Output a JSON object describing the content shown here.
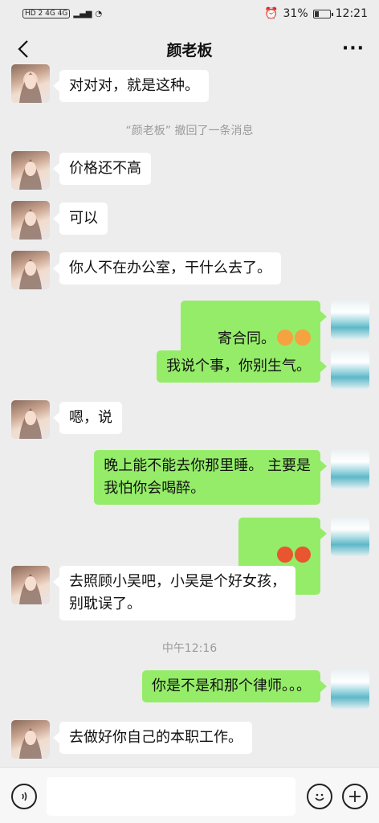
{
  "status_bar": {
    "network": "HD 2 4G 4G",
    "battery_percent": "31%",
    "battery_level": 0.31,
    "time": "12:21"
  },
  "nav": {
    "title": "颜老板",
    "more_label": "···"
  },
  "messages": [
    {
      "side": "left",
      "text": "对对对，就是这种。"
    },
    {
      "system": "“颜老板” 撤回了一条消息"
    },
    {
      "side": "left",
      "text": "价格还不高"
    },
    {
      "side": "left",
      "text": "可以"
    },
    {
      "side": "left",
      "text": "你人不在办公室，干什么去了。"
    },
    {
      "side": "right",
      "text": "寄合同。",
      "emojis": [
        "flushed-face",
        "flushed-face"
      ]
    },
    {
      "side": "right",
      "text": "我说个事，你别生气。"
    },
    {
      "side": "left",
      "text": "嗯，说"
    },
    {
      "side": "right",
      "text": "晚上能不能去你那里睡。 主要是\n我怕你会喝醉。"
    },
    {
      "side": "right",
      "text": "",
      "emojis": [
        "angry-face",
        "angry-face"
      ]
    },
    {
      "side": "left",
      "text": "去照顾小吴吧，小吴是个好女孩，\n别耽误了。"
    },
    {
      "system": "中午12:16"
    },
    {
      "side": "right",
      "text": "你是不是和那个律师。。。"
    },
    {
      "side": "left",
      "text": "去做好你自己的本职工作。"
    }
  ],
  "input_bar": {
    "voice_icon": "voice-icon",
    "emoji_icon": "emoji-icon",
    "plus_icon": "plus-icon",
    "placeholder": ""
  },
  "colors": {
    "background": "#ededed",
    "bubble_self": "#95ec69",
    "bubble_other": "#ffffff",
    "system_text": "#9b9b9b"
  }
}
